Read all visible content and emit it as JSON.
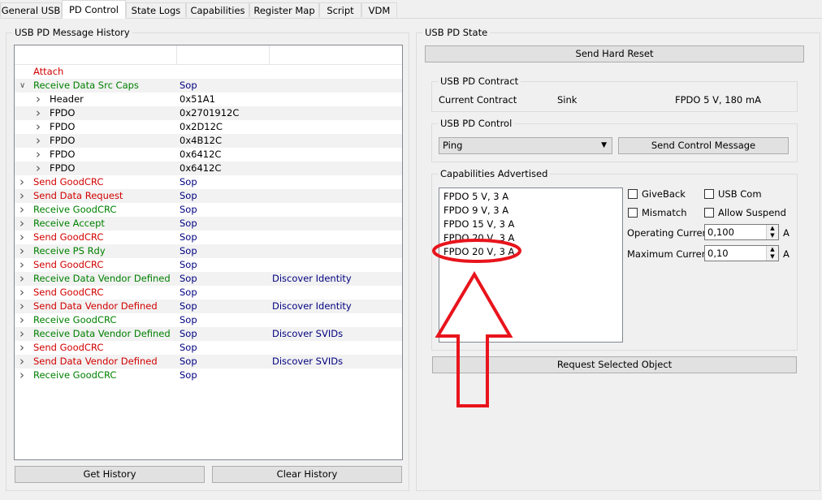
{
  "tabs": [
    {
      "label": "General USB",
      "active": false
    },
    {
      "label": "PD Control",
      "active": true
    },
    {
      "label": "State Logs",
      "active": false
    },
    {
      "label": "Capabilities",
      "active": false
    },
    {
      "label": "Register Map",
      "active": false
    },
    {
      "label": "Script",
      "active": false
    },
    {
      "label": "VDM",
      "active": false
    }
  ],
  "history": {
    "title": "USB PD Message History",
    "rows": [
      {
        "message": "Attach",
        "type": "",
        "detail": "",
        "color": "red",
        "chevron": "",
        "child": false
      },
      {
        "message": "Receive Data Src Caps",
        "type": "Sop",
        "detail": "",
        "color": "green",
        "chevron": "expanded",
        "child": false
      },
      {
        "message": "Header",
        "type": "0x51A1",
        "detail": "",
        "color": "black",
        "chevron": "collapsed",
        "child": true
      },
      {
        "message": "FPDO",
        "type": "0x2701912C",
        "detail": "",
        "color": "black",
        "chevron": "collapsed",
        "child": true
      },
      {
        "message": "FPDO",
        "type": "0x2D12C",
        "detail": "",
        "color": "black",
        "chevron": "collapsed",
        "child": true
      },
      {
        "message": "FPDO",
        "type": "0x4B12C",
        "detail": "",
        "color": "black",
        "chevron": "collapsed",
        "child": true
      },
      {
        "message": "FPDO",
        "type": "0x6412C",
        "detail": "",
        "color": "black",
        "chevron": "collapsed",
        "child": true
      },
      {
        "message": "FPDO",
        "type": "0x6412C",
        "detail": "",
        "color": "black",
        "chevron": "collapsed",
        "child": true
      },
      {
        "message": "Send GoodCRC",
        "type": "Sop",
        "detail": "",
        "color": "red",
        "chevron": "collapsed",
        "child": false
      },
      {
        "message": "Send Data Request",
        "type": "Sop",
        "detail": "",
        "color": "red",
        "chevron": "collapsed",
        "child": false
      },
      {
        "message": "Receive GoodCRC",
        "type": "Sop",
        "detail": "",
        "color": "green",
        "chevron": "collapsed",
        "child": false
      },
      {
        "message": "Receive Accept",
        "type": "Sop",
        "detail": "",
        "color": "green",
        "chevron": "collapsed",
        "child": false
      },
      {
        "message": "Send GoodCRC",
        "type": "Sop",
        "detail": "",
        "color": "red",
        "chevron": "collapsed",
        "child": false
      },
      {
        "message": "Receive PS Rdy",
        "type": "Sop",
        "detail": "",
        "color": "green",
        "chevron": "collapsed",
        "child": false
      },
      {
        "message": "Send GoodCRC",
        "type": "Sop",
        "detail": "",
        "color": "red",
        "chevron": "collapsed",
        "child": false
      },
      {
        "message": "Receive Data Vendor Defined",
        "type": "Sop",
        "detail": "Discover Identity",
        "color": "green",
        "chevron": "collapsed",
        "child": false
      },
      {
        "message": "Send GoodCRC",
        "type": "Sop",
        "detail": "",
        "color": "red",
        "chevron": "collapsed",
        "child": false
      },
      {
        "message": "Send Data Vendor Defined",
        "type": "Sop",
        "detail": "Discover Identity",
        "color": "red",
        "chevron": "collapsed",
        "child": false
      },
      {
        "message": "Receive GoodCRC",
        "type": "Sop",
        "detail": "",
        "color": "green",
        "chevron": "collapsed",
        "child": false
      },
      {
        "message": "Receive Data Vendor Defined",
        "type": "Sop",
        "detail": "Discover SVIDs",
        "color": "green",
        "chevron": "collapsed",
        "child": false
      },
      {
        "message": "Send GoodCRC",
        "type": "Sop",
        "detail": "",
        "color": "red",
        "chevron": "collapsed",
        "child": false
      },
      {
        "message": "Send Data Vendor Defined",
        "type": "Sop",
        "detail": "Discover SVIDs",
        "color": "red",
        "chevron": "collapsed",
        "child": false
      },
      {
        "message": "Receive GoodCRC",
        "type": "Sop",
        "detail": "",
        "color": "green",
        "chevron": "collapsed",
        "child": false
      }
    ],
    "get_history_label": "Get History",
    "clear_history_label": "Clear History"
  },
  "state": {
    "title": "USB PD State",
    "hard_reset_label": "Send Hard Reset",
    "contract": {
      "title": "USB PD Contract",
      "label": "Current Contract",
      "role": "Sink",
      "value": "FPDO 5 V, 180 mA"
    },
    "control": {
      "title": "USB PD Control",
      "selected": "Ping",
      "send_label": "Send Control Message"
    },
    "caps": {
      "title": "Capabilities Advertised",
      "items": [
        "FPDO 5 V, 3 A",
        "FPDO 9 V, 3 A",
        "FPDO 15 V, 3 A",
        "FPDO 20 V, 3 A",
        "FPDO 20 V, 3 A"
      ],
      "giveback_label": "GiveBack",
      "usbcom_label": "USB Com",
      "mismatch_label": "Mismatch",
      "allow_suspend_label": "Allow Suspend",
      "operating_label": "Operating Current",
      "operating_value": "0,100",
      "maximum_label": "Maximum Current",
      "maximum_value": "0,10",
      "unit": "A",
      "request_label": "Request Selected Object"
    }
  },
  "colors": {
    "send": "#d20000",
    "receive": "#008000",
    "type": "#000080",
    "annotation": "#e8141c"
  }
}
